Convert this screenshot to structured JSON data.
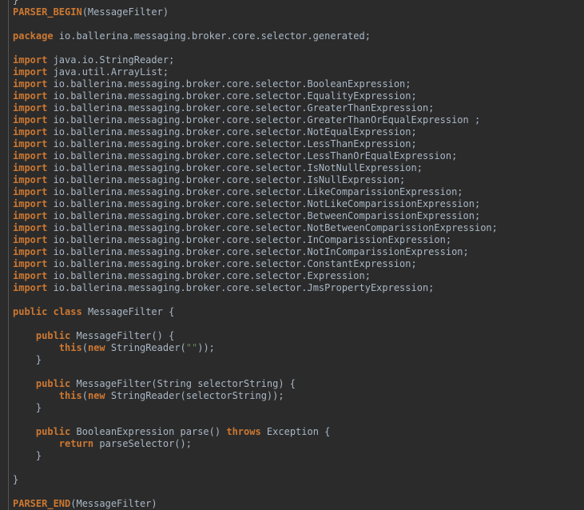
{
  "editor": {
    "lines": [
      [
        {
          "t": "}",
          "k": "plain"
        }
      ],
      [
        {
          "t": "PARSER_BEGIN",
          "k": "kw"
        },
        {
          "t": "(MessageFilter)",
          "k": "plain"
        }
      ],
      [],
      [
        {
          "t": "package",
          "k": "kw"
        },
        {
          "t": " io.ballerina.messaging.broker.core.selector.generated;",
          "k": "plain"
        }
      ],
      [],
      [
        {
          "t": "import",
          "k": "kw"
        },
        {
          "t": " java.io.StringReader;",
          "k": "plain"
        }
      ],
      [
        {
          "t": "import",
          "k": "kw"
        },
        {
          "t": " java.util.ArrayList;",
          "k": "plain"
        }
      ],
      [
        {
          "t": "import",
          "k": "kw"
        },
        {
          "t": " io.ballerina.messaging.broker.core.selector.BooleanExpression;",
          "k": "plain"
        }
      ],
      [
        {
          "t": "import",
          "k": "kw"
        },
        {
          "t": " io.ballerina.messaging.broker.core.selector.EqualityExpression;",
          "k": "plain"
        }
      ],
      [
        {
          "t": "import",
          "k": "kw"
        },
        {
          "t": " io.ballerina.messaging.broker.core.selector.GreaterThanExpression;",
          "k": "plain"
        }
      ],
      [
        {
          "t": "import",
          "k": "kw"
        },
        {
          "t": " io.ballerina.messaging.broker.core.selector.GreaterThanOrEqualExpression ;",
          "k": "plain"
        }
      ],
      [
        {
          "t": "import",
          "k": "kw"
        },
        {
          "t": " io.ballerina.messaging.broker.core.selector.NotEqualExpression;",
          "k": "plain"
        }
      ],
      [
        {
          "t": "import",
          "k": "kw"
        },
        {
          "t": " io.ballerina.messaging.broker.core.selector.LessThanExpression;",
          "k": "plain"
        }
      ],
      [
        {
          "t": "import",
          "k": "kw"
        },
        {
          "t": " io.ballerina.messaging.broker.core.selector.LessThanOrEqualExpression;",
          "k": "plain"
        }
      ],
      [
        {
          "t": "import",
          "k": "kw"
        },
        {
          "t": " io.ballerina.messaging.broker.core.selector.IsNotNullExpression;",
          "k": "plain"
        }
      ],
      [
        {
          "t": "import",
          "k": "kw"
        },
        {
          "t": " io.ballerina.messaging.broker.core.selector.IsNullExpression;",
          "k": "plain"
        }
      ],
      [
        {
          "t": "import",
          "k": "kw"
        },
        {
          "t": " io.ballerina.messaging.broker.core.selector.LikeComparissionExpression;",
          "k": "plain"
        }
      ],
      [
        {
          "t": "import",
          "k": "kw"
        },
        {
          "t": " io.ballerina.messaging.broker.core.selector.NotLikeComparissionExpression;",
          "k": "plain"
        }
      ],
      [
        {
          "t": "import",
          "k": "kw"
        },
        {
          "t": " io.ballerina.messaging.broker.core.selector.BetweenComparissionExpression;",
          "k": "plain"
        }
      ],
      [
        {
          "t": "import",
          "k": "kw"
        },
        {
          "t": " io.ballerina.messaging.broker.core.selector.NotBetweenComparissionExpression;",
          "k": "plain"
        }
      ],
      [
        {
          "t": "import",
          "k": "kw"
        },
        {
          "t": " io.ballerina.messaging.broker.core.selector.InComparissionExpression;",
          "k": "plain"
        }
      ],
      [
        {
          "t": "import",
          "k": "kw"
        },
        {
          "t": " io.ballerina.messaging.broker.core.selector.NotInComparissionExpression;",
          "k": "plain"
        }
      ],
      [
        {
          "t": "import",
          "k": "kw"
        },
        {
          "t": " io.ballerina.messaging.broker.core.selector.ConstantExpression;",
          "k": "plain"
        }
      ],
      [
        {
          "t": "import",
          "k": "kw"
        },
        {
          "t": " io.ballerina.messaging.broker.core.selector.Expression;",
          "k": "plain"
        }
      ],
      [
        {
          "t": "import",
          "k": "kw"
        },
        {
          "t": " io.ballerina.messaging.broker.core.selector.JmsPropertyExpression;",
          "k": "plain"
        }
      ],
      [],
      [
        {
          "t": "public",
          "k": "kw"
        },
        {
          "t": " ",
          "k": "plain"
        },
        {
          "t": "class",
          "k": "kw"
        },
        {
          "t": " MessageFilter {",
          "k": "plain"
        }
      ],
      [],
      [
        {
          "t": "    ",
          "k": "plain"
        },
        {
          "t": "public",
          "k": "kw"
        },
        {
          "t": " MessageFilter() {",
          "k": "plain"
        }
      ],
      [
        {
          "t": "        ",
          "k": "plain"
        },
        {
          "t": "this",
          "k": "kw"
        },
        {
          "t": "(",
          "k": "plain"
        },
        {
          "t": "new",
          "k": "kw"
        },
        {
          "t": " StringReader(",
          "k": "plain"
        },
        {
          "t": "\"\"",
          "k": "str"
        },
        {
          "t": "));",
          "k": "plain"
        }
      ],
      [
        {
          "t": "    }",
          "k": "plain"
        }
      ],
      [],
      [
        {
          "t": "    ",
          "k": "plain"
        },
        {
          "t": "public",
          "k": "kw"
        },
        {
          "t": " MessageFilter(String selectorString) {",
          "k": "plain"
        }
      ],
      [
        {
          "t": "        ",
          "k": "plain"
        },
        {
          "t": "this",
          "k": "kw"
        },
        {
          "t": "(",
          "k": "plain"
        },
        {
          "t": "new",
          "k": "kw"
        },
        {
          "t": " StringReader(selectorString));",
          "k": "plain"
        }
      ],
      [
        {
          "t": "    }",
          "k": "plain"
        }
      ],
      [],
      [
        {
          "t": "    ",
          "k": "plain"
        },
        {
          "t": "public",
          "k": "kw"
        },
        {
          "t": " BooleanExpression parse() ",
          "k": "plain"
        },
        {
          "t": "throws",
          "k": "kw"
        },
        {
          "t": " Exception {",
          "k": "plain"
        }
      ],
      [
        {
          "t": "        ",
          "k": "plain"
        },
        {
          "t": "return",
          "k": "kw"
        },
        {
          "t": " parseSelector();",
          "k": "plain"
        }
      ],
      [
        {
          "t": "    }",
          "k": "plain"
        }
      ],
      [],
      [
        {
          "t": "}",
          "k": "plain"
        }
      ],
      [],
      [
        {
          "t": "PARSER_END",
          "k": "kw"
        },
        {
          "t": "(MessageFilter)",
          "k": "plain"
        }
      ]
    ]
  }
}
